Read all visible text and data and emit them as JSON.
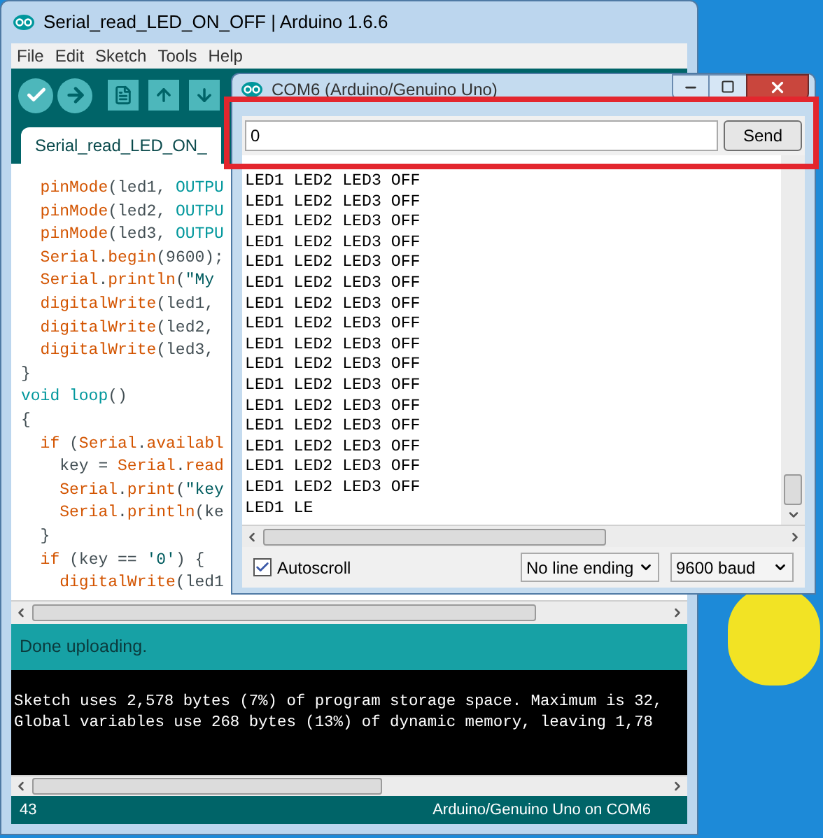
{
  "main_window": {
    "title": "Serial_read_LED_ON_OFF | Arduino 1.6.6",
    "menu": [
      "File",
      "Edit",
      "Sketch",
      "Tools",
      "Help"
    ],
    "tab": {
      "label": "Serial_read_LED_ON_"
    },
    "code_lines": [
      [
        {
          "t": "  pinMode",
          "kind": "fn"
        },
        {
          "t": "(led1, "
        },
        {
          "t": "OUTPU",
          "kind": "const"
        }
      ],
      [
        {
          "t": "  pinMode",
          "kind": "fn"
        },
        {
          "t": "(led2, "
        },
        {
          "t": "OUTPU",
          "kind": "const"
        }
      ],
      [
        {
          "t": "  pinMode",
          "kind": "fn"
        },
        {
          "t": "(led3, "
        },
        {
          "t": "OUTPU",
          "kind": "const"
        }
      ],
      [
        {
          "t": "  Serial",
          "kind": "fn"
        },
        {
          "t": "."
        },
        {
          "t": "begin",
          "kind": "fn"
        },
        {
          "t": "(9600);"
        }
      ],
      [
        {
          "t": "  Serial",
          "kind": "fn"
        },
        {
          "t": "."
        },
        {
          "t": "println",
          "kind": "fn"
        },
        {
          "t": "("
        },
        {
          "t": "\"My",
          "kind": "str"
        }
      ],
      [
        {
          "t": "  digitalWrite",
          "kind": "fn"
        },
        {
          "t": "(led1,"
        }
      ],
      [
        {
          "t": "  digitalWrite",
          "kind": "fn"
        },
        {
          "t": "(led2,"
        }
      ],
      [
        {
          "t": "  digitalWrite",
          "kind": "fn"
        },
        {
          "t": "(led3,"
        }
      ],
      [
        {
          "t": "}"
        }
      ],
      [
        {
          "t": "void loop",
          "kind": "kw"
        },
        {
          "t": "()"
        }
      ],
      [
        {
          "t": "{"
        }
      ],
      [
        {
          "t": "  if",
          "kind": "fn"
        },
        {
          "t": " ("
        },
        {
          "t": "Serial",
          "kind": "fn"
        },
        {
          "t": "."
        },
        {
          "t": "availabl",
          "kind": "fn"
        }
      ],
      [
        {
          "t": "    key = "
        },
        {
          "t": "Serial",
          "kind": "fn"
        },
        {
          "t": "."
        },
        {
          "t": "read",
          "kind": "fn"
        }
      ],
      [
        {
          "t": "    Serial",
          "kind": "fn"
        },
        {
          "t": "."
        },
        {
          "t": "print",
          "kind": "fn"
        },
        {
          "t": "("
        },
        {
          "t": "\"key",
          "kind": "str"
        }
      ],
      [
        {
          "t": "    Serial",
          "kind": "fn"
        },
        {
          "t": "."
        },
        {
          "t": "println",
          "kind": "fn"
        },
        {
          "t": "(ke"
        }
      ],
      [
        {
          "t": "  }"
        }
      ],
      [
        {
          "t": "  if",
          "kind": "fn"
        },
        {
          "t": " (key == "
        },
        {
          "t": "'0'",
          "kind": "str"
        },
        {
          "t": ") {"
        }
      ],
      [
        {
          "t": "    digitalWrite",
          "kind": "fn"
        },
        {
          "t": "(led1"
        }
      ]
    ],
    "status_message": "Done uploading.",
    "console_lines": [
      "Sketch uses 2,578 bytes (7%) of program storage space. Maximum is 32,",
      "Global variables use 268 bytes (13%) of dynamic memory, leaving 1,78"
    ],
    "status_bar": {
      "line": "43",
      "board": "Arduino/Genuino Uno on COM6"
    }
  },
  "serial_monitor": {
    "title": "COM6 (Arduino/Genuino Uno)",
    "input": {
      "value": "0"
    },
    "send_button": "Send",
    "output_lines": [
      "LED1 LED2 LED3 OFF",
      "LED1 LED2 LED3 OFF",
      "LED1 LED2 LED3 OFF",
      "LED1 LED2 LED3 OFF",
      "LED1 LED2 LED3 OFF",
      "LED1 LED2 LED3 OFF",
      "LED1 LED2 LED3 OFF",
      "LED1 LED2 LED3 OFF",
      "LED1 LED2 LED3 OFF",
      "LED1 LED2 LED3 OFF",
      "LED1 LED2 LED3 OFF",
      "LED1 LED2 LED3 OFF",
      "LED1 LED2 LED3 OFF",
      "LED1 LED2 LED3 OFF",
      "LED1 LED2 LED3 OFF",
      "LED1 LED2 LED3 OFF",
      "LED1 LE"
    ],
    "autoscroll": {
      "label": "Autoscroll",
      "checked": true
    },
    "line_ending": "No line ending",
    "baud": "9600 baud"
  }
}
